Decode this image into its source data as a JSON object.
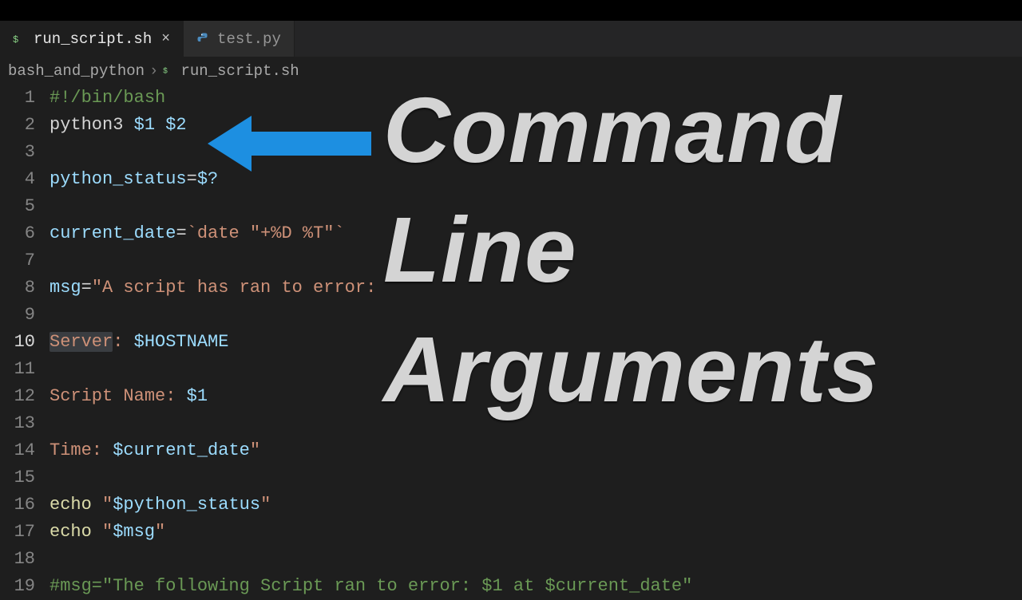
{
  "tabs": [
    {
      "label": "run_script.sh",
      "active": true,
      "icon": "bash"
    },
    {
      "label": "test.py",
      "active": false,
      "icon": "python"
    }
  ],
  "breadcrumbs": {
    "folder": "bash_and_python",
    "file": "run_script.sh"
  },
  "lines": [
    {
      "n": 1,
      "html": "<span class='c-green'>#!/bin/bash</span>"
    },
    {
      "n": 2,
      "html": "<span class='c-text'>python3 </span><span class='c-var'>$1</span><span class='c-text'> </span><span class='c-var'>$2</span>"
    },
    {
      "n": 3,
      "html": ""
    },
    {
      "n": 4,
      "html": "<span class='c-var'>python_status</span><span class='c-white'>=</span><span class='c-var'>$?</span>"
    },
    {
      "n": 5,
      "html": ""
    },
    {
      "n": 6,
      "html": "<span class='c-var'>current_date</span><span class='c-white'>=</span><span class='c-orange'>`date </span><span class='c-orange'>\"+%D %T\"</span><span class='c-orange'>`</span>"
    },
    {
      "n": 7,
      "html": ""
    },
    {
      "n": 8,
      "html": "<span class='c-var'>msg</span><span class='c-white'>=</span><span class='c-orange'>\"A script has ran to error:</span>"
    },
    {
      "n": 9,
      "html": ""
    },
    {
      "n": 10,
      "html": "<span class='c-orange sel'>Server</span><span class='c-orange'>: </span><span class='c-var'>$HOSTNAME</span>",
      "current": true
    },
    {
      "n": 11,
      "html": ""
    },
    {
      "n": 12,
      "html": "<span class='c-orange'>Script Name: </span><span class='c-var'>$1</span>"
    },
    {
      "n": 13,
      "html": ""
    },
    {
      "n": 14,
      "html": "<span class='c-orange'>Time: </span><span class='c-var'>$current_date</span><span class='c-orange'>\"</span>"
    },
    {
      "n": 15,
      "html": ""
    },
    {
      "n": 16,
      "html": "<span class='c-cmd'>echo</span><span class='c-text'> </span><span class='c-orange'>\"</span><span class='c-var'>$python_status</span><span class='c-orange'>\"</span>"
    },
    {
      "n": 17,
      "html": "<span class='c-cmd'>echo</span><span class='c-text'> </span><span class='c-orange'>\"</span><span class='c-var'>$msg</span><span class='c-orange'>\"</span>"
    },
    {
      "n": 18,
      "html": ""
    },
    {
      "n": 19,
      "html": "<span class='c-green'>#msg=\"The following Script ran to error: $1 at $current_date\"</span>"
    }
  ],
  "overlay": {
    "line1": "Command",
    "line2": "Line",
    "line3": "Arguments",
    "arrow_color": "#1d8fe1"
  }
}
